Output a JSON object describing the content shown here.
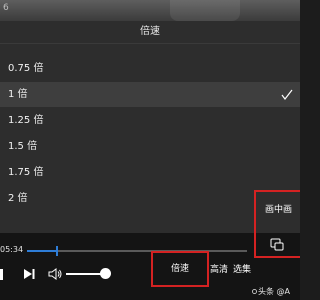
{
  "top_strip": {
    "label": "6"
  },
  "speed_menu": {
    "title": "倍速",
    "options": [
      {
        "label": "0.75 倍"
      },
      {
        "label": "1 倍"
      },
      {
        "label": "1.25 倍"
      },
      {
        "label": "1.5 倍"
      },
      {
        "label": "1.75 倍"
      },
      {
        "label": "2 倍"
      }
    ],
    "selected": "1 倍"
  },
  "player": {
    "current_time": "05:34",
    "progress_fraction": 0.13,
    "volume_fraction": 0.85
  },
  "controls": {
    "speed_label": "倍速",
    "quality_label": "高清",
    "episode_label": "选集",
    "pip_label": "画中画"
  },
  "watermark": {
    "text": "头条 @A"
  },
  "colors": {
    "accent_blue": "#2e7dd7",
    "highlight_red": "#d42222",
    "panel_bg": "#2d2d2d"
  },
  "icons": {
    "check": "check-icon",
    "next": "next-icon",
    "volume": "volume-icon",
    "pip": "pip-icon"
  }
}
